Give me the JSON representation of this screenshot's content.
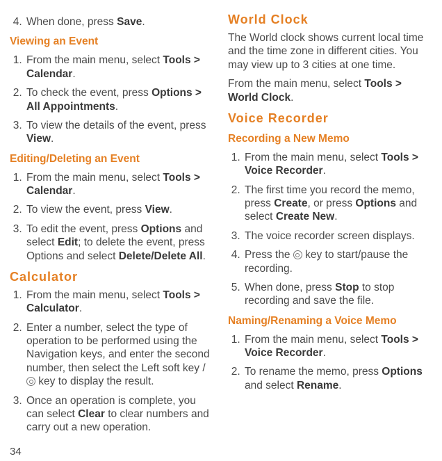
{
  "page_number": "34",
  "col_left": {
    "item0_before": "When done, press ",
    "item0_bold": "Save",
    "sub1": "Viewing an Event",
    "l1_1a": "From the main menu, select ",
    "l1_1b": "Tools > Calendar",
    "l1_2a": "To check the event, press ",
    "l1_2b": "Options > All Appointments",
    "l1_3a": "To view the details of the event, press ",
    "l1_3b": "View",
    "sub2": "Editing/Deleting an Event",
    "l2_1a": "From the main menu, select ",
    "l2_1b": "Tools > Calendar",
    "l2_2a": "To view the event, press ",
    "l2_2b": "View",
    "l2_3a": "To edit the event, press ",
    "l2_3b": "Options",
    "l2_3c": " and select ",
    "l2_3d": "Edit",
    "l2_3e": "; to delete the event, press Options and select ",
    "l2_3f": "Delete/Delete All",
    "sec_calc": "Calculator",
    "l3_1a": "From the main menu, select ",
    "l3_1b": "Tools > Calculator",
    "l3_2": "Enter a number, select the type of operation to be performed using the Navigation keys, and enter the second number, then select the Left soft key / ",
    "l3_2_after": " key to display the result.",
    "l3_3a": "Once an operation is complete, you can select ",
    "l3_3b": "Clear",
    "l3_3c": " to clear numbers and carry out a new operation."
  },
  "col_right": {
    "sec_wc": "World Clock",
    "wc_p1": "The World clock shows current local time and the time zone in different cities. You may view up to 3 cities at one time.",
    "wc_p2a": "From the main menu, select ",
    "wc_p2b": "Tools > World Clock",
    "sec_vr": "Voice Recorder",
    "sub_rm": "Recording a New Memo",
    "r1_1a": "From the main menu, select ",
    "r1_1b": "Tools > Voice Recorder",
    "r1_2a": "The first time you record the memo, press ",
    "r1_2b": "Create",
    "r1_2c": ", or press ",
    "r1_2d": "Options",
    "r1_2e": " and select ",
    "r1_2f": "Create New",
    "r1_3": "The voice recorder screen displays.",
    "r1_4a": "Press the ",
    "r1_4b": " key to start/pause the recording.",
    "r1_5a": "When done, press ",
    "r1_5b": "Stop",
    "r1_5c": " to stop recording and save the file.",
    "sub_nr": "Naming/Renaming a Voice Memo",
    "r2_1a": "From the main menu, select ",
    "r2_1b": "Tools > Voice Recorder",
    "r2_2a": "To rename the memo, press ",
    "r2_2b": "Options",
    "r2_2c": " and select ",
    "r2_2d": "Rename"
  }
}
